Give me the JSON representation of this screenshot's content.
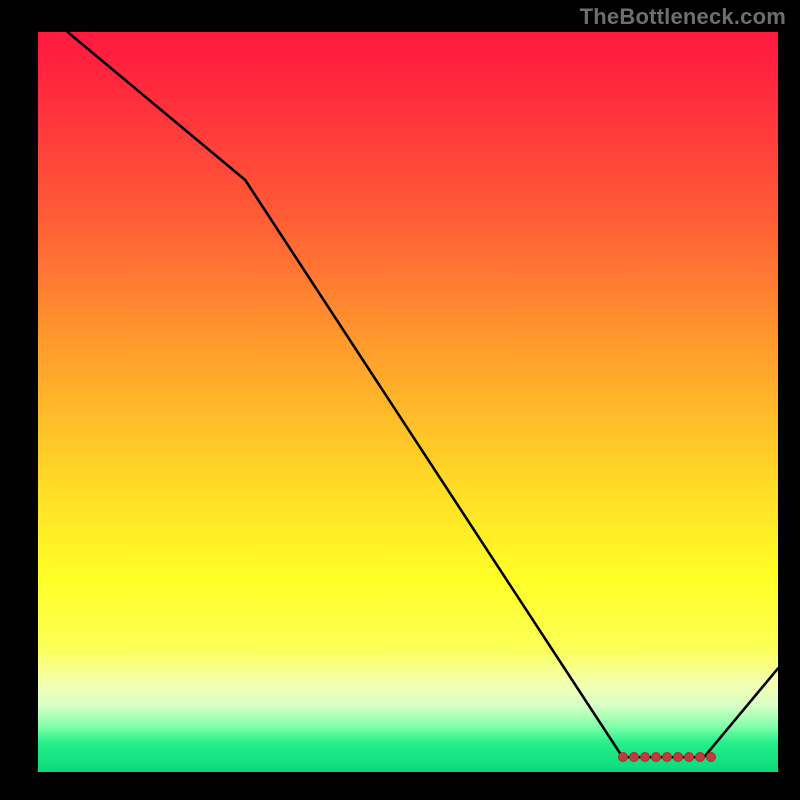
{
  "watermark": "TheBottleneck.com",
  "colors": {
    "page_bg": "#000000",
    "watermark_text": "#6e6e6e",
    "curve_stroke": "#000000",
    "marker_fill": "#c23a3a",
    "gradient_top": "#ff193f",
    "gradient_bottom": "#09d97a"
  },
  "chart_data": {
    "type": "line",
    "title": "",
    "xlabel": "",
    "ylabel": "",
    "xlim": [
      0,
      100
    ],
    "ylim": [
      0,
      100
    ],
    "grid": false,
    "legend": false,
    "series": [
      {
        "name": "bottleneck-curve",
        "x": [
          4,
          28,
          79,
          90,
          100
        ],
        "y": [
          100,
          80,
          2,
          2,
          14
        ]
      }
    ],
    "markers": {
      "name": "highlighted-points",
      "x": [
        79,
        80.5,
        82,
        83.5,
        85,
        86.5,
        88,
        89.5,
        91
      ],
      "y": [
        2,
        2,
        2,
        2,
        2,
        2,
        2,
        2,
        2
      ]
    }
  }
}
